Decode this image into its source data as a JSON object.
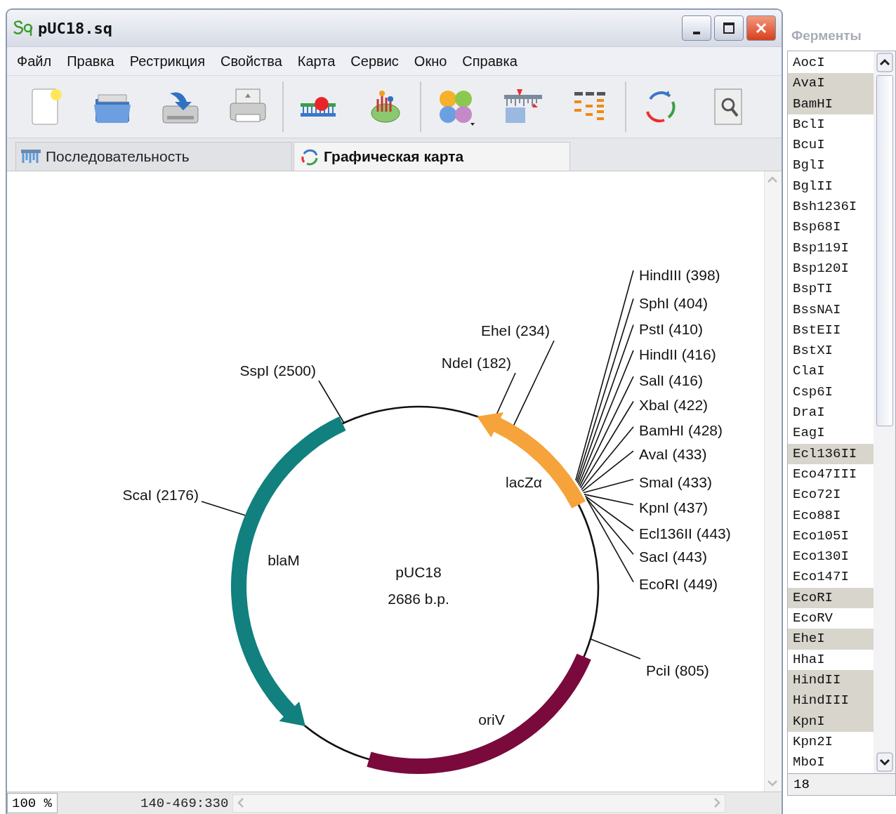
{
  "window": {
    "title": "pUC18.sq"
  },
  "menu": [
    "Файл",
    "Правка",
    "Рестрикция",
    "Свойства",
    "Карта",
    "Сервис",
    "Окно",
    "Справка"
  ],
  "tabs": [
    {
      "label": "Последовательность",
      "selected": false
    },
    {
      "label": "Графическая карта",
      "selected": true
    }
  ],
  "map": {
    "name": "pUC18",
    "length": "2686 b.p.",
    "features": [
      {
        "label": "lacZα",
        "kind": "arrow-ccw",
        "color": "#f5a33a"
      },
      {
        "label": "blaM",
        "kind": "arrow-ccw",
        "color": "#11807f"
      },
      {
        "label": "oriV",
        "kind": "segment",
        "color": "#7a0a3c"
      }
    ],
    "sites": [
      {
        "label": "SspI (2500)"
      },
      {
        "label": "ScaI (2176)"
      },
      {
        "label": "NdeI (182)"
      },
      {
        "label": "EheI (234)"
      },
      {
        "label": "HindIII (398)"
      },
      {
        "label": "SphI (404)"
      },
      {
        "label": "PstI (410)"
      },
      {
        "label": "HindII (416)"
      },
      {
        "label": "SalI (416)"
      },
      {
        "label": "XbaI (422)"
      },
      {
        "label": "BamHI (428)"
      },
      {
        "label": "AvaI (433)"
      },
      {
        "label": "SmaI (433)"
      },
      {
        "label": "KpnI (437)"
      },
      {
        "label": "Ecl136II (443)"
      },
      {
        "label": "SacI (443)"
      },
      {
        "label": "EcoRI (449)"
      },
      {
        "label": "PciI (805)"
      }
    ]
  },
  "status_bar": {
    "zoom": "100 %",
    "range": "140-469:330"
  },
  "enzymes_panel": {
    "title": "Ферменты",
    "count": "18",
    "items": [
      {
        "name": "AocI",
        "selected": false
      },
      {
        "name": "AvaI",
        "selected": true
      },
      {
        "name": "BamHI",
        "selected": true
      },
      {
        "name": "BclI",
        "selected": false
      },
      {
        "name": "BcuI",
        "selected": false
      },
      {
        "name": "BglI",
        "selected": false
      },
      {
        "name": "BglII",
        "selected": false
      },
      {
        "name": "Bsh1236I",
        "selected": false
      },
      {
        "name": "Bsp68I",
        "selected": false
      },
      {
        "name": "Bsp119I",
        "selected": false
      },
      {
        "name": "Bsp120I",
        "selected": false
      },
      {
        "name": "BspTI",
        "selected": false
      },
      {
        "name": "BssNAI",
        "selected": false
      },
      {
        "name": "BstEII",
        "selected": false
      },
      {
        "name": "BstXI",
        "selected": false
      },
      {
        "name": "ClaI",
        "selected": false
      },
      {
        "name": "Csp6I",
        "selected": false
      },
      {
        "name": "DraI",
        "selected": false
      },
      {
        "name": "EagI",
        "selected": false
      },
      {
        "name": "Ecl136II",
        "selected": true
      },
      {
        "name": "Eco47III",
        "selected": false
      },
      {
        "name": "Eco72I",
        "selected": false
      },
      {
        "name": "Eco88I",
        "selected": false
      },
      {
        "name": "Eco105I",
        "selected": false
      },
      {
        "name": "Eco130I",
        "selected": false
      },
      {
        "name": "Eco147I",
        "selected": false
      },
      {
        "name": "EcoRI",
        "selected": true
      },
      {
        "name": "EcoRV",
        "selected": false
      },
      {
        "name": "EheI",
        "selected": true
      },
      {
        "name": "HhaI",
        "selected": false
      },
      {
        "name": "HindII",
        "selected": true
      },
      {
        "name": "HindIII",
        "selected": true
      },
      {
        "name": "KpnI",
        "selected": true
      },
      {
        "name": "Kpn2I",
        "selected": false
      },
      {
        "name": "MboI",
        "selected": false
      }
    ]
  }
}
